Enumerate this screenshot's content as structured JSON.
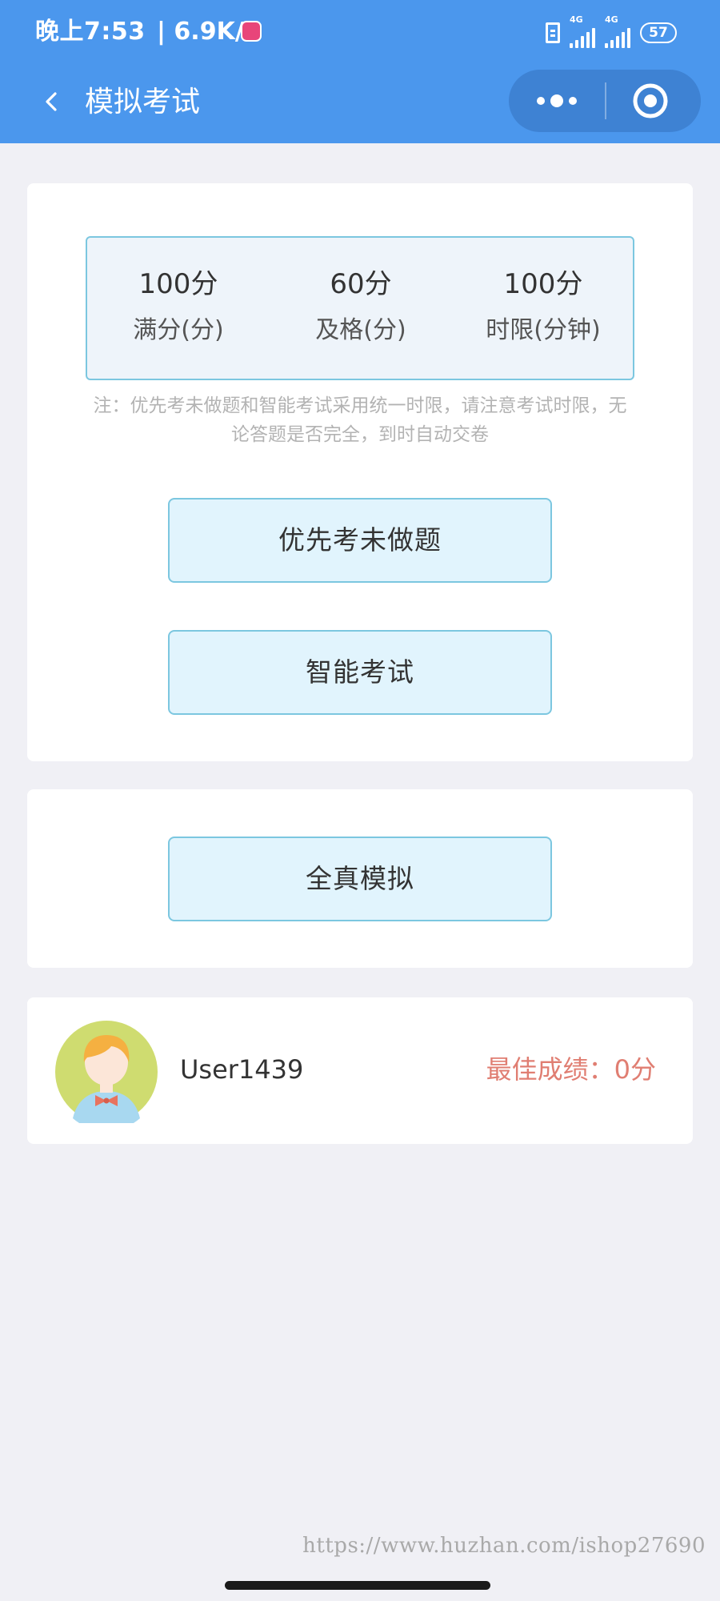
{
  "status_bar": {
    "time": "晚上7:53",
    "separator": "|",
    "net_speed": "6.9K/s",
    "signal1_type": "4G",
    "signal2_type": "4G",
    "battery": "57"
  },
  "nav": {
    "title": "模拟考试",
    "back_icon": "chevron-left-icon",
    "more_icon": "more-dots-icon",
    "close_icon": "target-close-icon"
  },
  "exam_info": {
    "items": [
      {
        "value": "100分",
        "label": "满分(分)"
      },
      {
        "value": "60分",
        "label": "及格(分)"
      },
      {
        "value": "100分",
        "label": "时限(分钟)"
      }
    ],
    "notice": "注：优先考未做题和智能考试采用统一时限，请注意考试时限，无论答题是否完全，到时自动交卷"
  },
  "actions": {
    "priority_unanswered": "优先考未做题",
    "smart_exam": "智能考试",
    "full_simulation": "全真模拟"
  },
  "user": {
    "name": "User1439",
    "best_score": "最佳成绩：0分"
  },
  "watermark": "https://www.huzhan.com/ishop27690",
  "colors": {
    "header": "#4b97ed",
    "capsule": "#3e82d3",
    "button_bg": "#e1f4fd",
    "button_border": "#7cc7e0",
    "score_text": "#e07e72",
    "page_bg": "#f0f0f5"
  }
}
